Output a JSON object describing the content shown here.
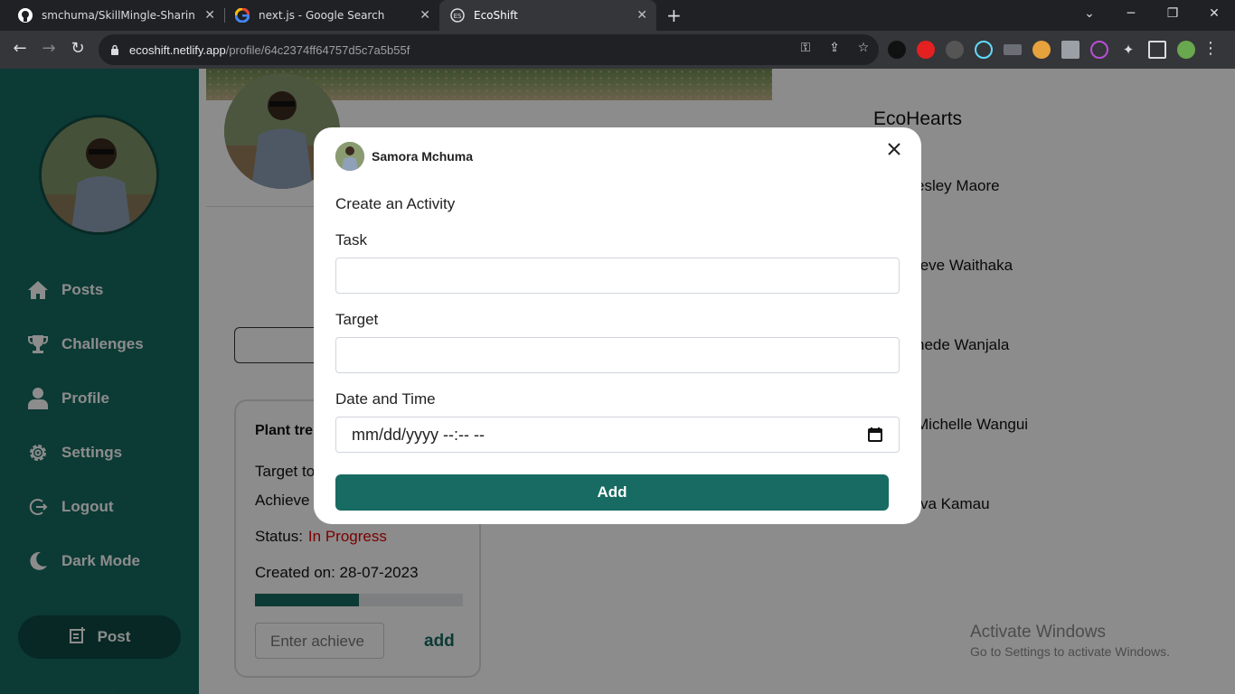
{
  "browser": {
    "tabs": [
      {
        "title": "smchuma/SkillMingle-Sharing-S",
        "icon": "github-icon"
      },
      {
        "title": "next.js - Google Search",
        "icon": "google-icon"
      },
      {
        "title": "EcoShift",
        "icon": "ecoshift-icon"
      }
    ],
    "url_host": "ecoshift.netlify.app",
    "url_path": "/profile/64c2374ff64757d5c7a5b55f"
  },
  "sidebar": {
    "items": [
      {
        "label": "Posts",
        "icon": "home-icon"
      },
      {
        "label": "Challenges",
        "icon": "trophy-icon"
      },
      {
        "label": "Profile",
        "icon": "user-icon"
      },
      {
        "label": "Settings",
        "icon": "gear-icon"
      },
      {
        "label": "Logout",
        "icon": "logout-icon"
      },
      {
        "label": "Dark Mode",
        "icon": "moon-icon"
      }
    ],
    "post_button": "Post"
  },
  "activity_card": {
    "title": "Plant tre",
    "target": "Target to",
    "achieved": "Achieve",
    "status_label": "Status:",
    "status_value": "In Progress",
    "created": "Created on: 28-07-2023",
    "progress_fraction": 0.5,
    "achieve_placeholder": "Enter achieve",
    "add_label": "add"
  },
  "ecohearts": {
    "title": "EcoHearts",
    "members": [
      "esley Maore",
      "teve Waithaka",
      "nede Wanjala",
      "Michelle Wangui",
      "va Kamau"
    ]
  },
  "modal": {
    "user_name": "Samora Mchuma",
    "heading": "Create an Activity",
    "task_label": "Task",
    "task_value": "",
    "target_label": "Target",
    "target_value": "",
    "datetime_label": "Date and Time",
    "datetime_placeholder": "mm/dd/yyyy --:-- --",
    "add_button": "Add"
  },
  "watermark": {
    "line1": "Activate Windows",
    "line2": "Go to Settings to activate Windows."
  },
  "colors": {
    "brand": "#176b62",
    "status_in_progress": "#e00000"
  }
}
